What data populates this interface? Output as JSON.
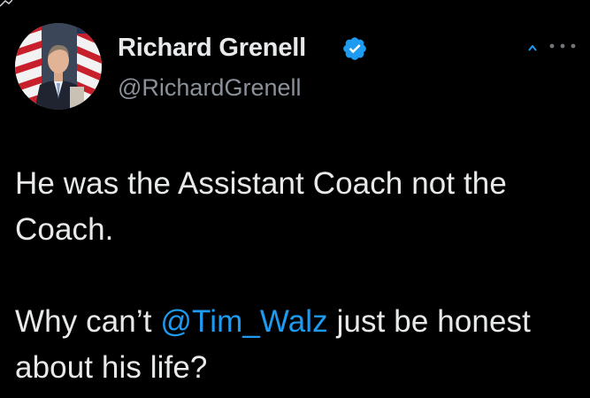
{
  "author": {
    "display_name": "Richard Grenell",
    "handle": "@RichardGrenell",
    "verified": true,
    "avatar_icon": "profile-photo"
  },
  "tweet": {
    "paragraph1": "He was the Assistant Coach not the Coach.",
    "paragraph2_before": "Why can’t ",
    "mention": "@Tim_Walz",
    "paragraph2_after": " just be honest about his life?"
  },
  "icons": {
    "verified": "verified-badge-icon",
    "more": "more-options-icon"
  },
  "colors": {
    "background": "#000000",
    "text": "#e7e9ea",
    "secondary_text": "#8b9199",
    "accent": "#1d9bf0"
  }
}
